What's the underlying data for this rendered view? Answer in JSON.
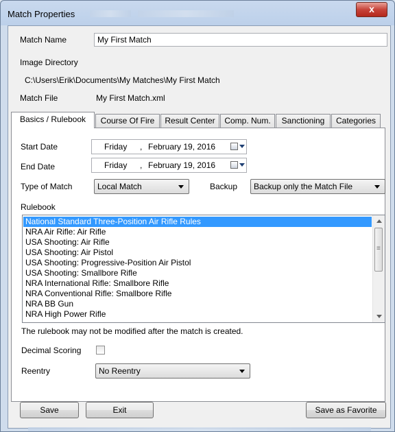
{
  "window": {
    "title": "Match Properties",
    "close_glyph": "x",
    "close_color": "#c7443a"
  },
  "header": {
    "match_name_label": "Match Name",
    "match_name_value": "My First Match",
    "image_directory_label": "Image Directory",
    "image_directory_value": "C:\\Users\\Erik\\Documents\\My Matches\\My First Match",
    "match_file_label": "Match File",
    "match_file_value": "My First Match.xml"
  },
  "tabs": [
    {
      "label": "Basics / Rulebook",
      "active": true
    },
    {
      "label": "Course Of Fire"
    },
    {
      "label": "Result Center"
    },
    {
      "label": "Comp. Num."
    },
    {
      "label": "Sanctioning"
    },
    {
      "label": "Categories"
    }
  ],
  "basics": {
    "start_date_label": "Start Date",
    "start_date": {
      "weekday": "Friday",
      "sep": ",",
      "month_day": "February 19, 2016"
    },
    "end_date_label": "End Date",
    "end_date": {
      "weekday": "Friday",
      "sep": ",",
      "month_day": "February 19, 2016"
    },
    "type_label": "Type of Match",
    "type_value": "Local Match",
    "backup_label": "Backup",
    "backup_value": "Backup only the Match File",
    "rulebook_label": "Rulebook",
    "rulebooks": [
      "National Standard Three-Position Air Rifle Rules",
      "NRA Air Rifle: Air Rifle",
      "USA Shooting: Air Rifle",
      "USA Shooting: Air Pistol",
      "USA Shooting: Progressive-Position Air Pistol",
      "USA Shooting: Smallbore Rifle",
      "NRA International Rifle: Smallbore Rifle",
      "NRA Conventional Rifle: Smallbore Rifle",
      "NRA BB Gun",
      "NRA High Power Rifle"
    ],
    "selected_rulebook_index": 0,
    "rulebook_note": "The rulebook may not be modified after the match is created.",
    "decimal_scoring_label": "Decimal Scoring",
    "decimal_scoring_checked": false,
    "reentry_label": "Reentry",
    "reentry_value": "No Reentry"
  },
  "footer": {
    "save_label": "Save",
    "exit_label": "Exit",
    "favorite_label": "Save as Favorite"
  },
  "colors": {
    "selection": "#3399ff",
    "title_bar": "#bcd0ea"
  }
}
